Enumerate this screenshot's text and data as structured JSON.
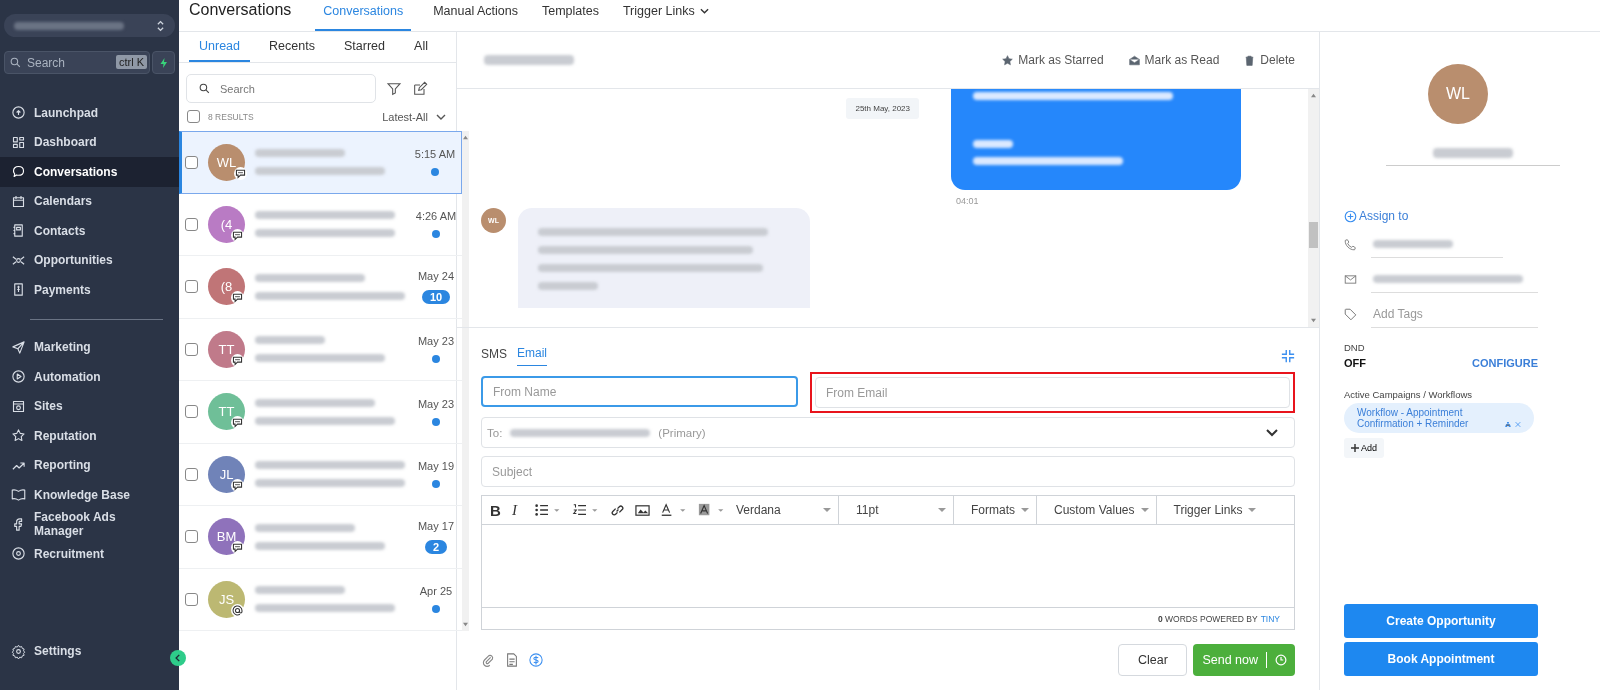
{
  "sidebar": {
    "search": {
      "placeholder": "Search",
      "shortcut": "ctrl K"
    },
    "sections": [
      [
        {
          "label": "Launchpad",
          "selected": false
        },
        {
          "label": "Dashboard",
          "selected": false
        },
        {
          "label": "Conversations",
          "selected": true
        },
        {
          "label": "Calendars",
          "selected": false
        },
        {
          "label": "Contacts",
          "selected": false
        },
        {
          "label": "Opportunities",
          "selected": false
        },
        {
          "label": "Payments",
          "selected": false
        }
      ],
      [
        {
          "label": "Marketing",
          "selected": false
        },
        {
          "label": "Automation",
          "selected": false
        },
        {
          "label": "Sites",
          "selected": false
        },
        {
          "label": "Reputation",
          "selected": false
        },
        {
          "label": "Reporting",
          "selected": false
        },
        {
          "label": "Knowledge Base",
          "selected": false
        },
        {
          "label": "Facebook Ads Manager",
          "selected": false
        },
        {
          "label": "Recruitment",
          "selected": false
        }
      ]
    ],
    "settings": "Settings"
  },
  "header": {
    "title": "Conversations",
    "tabs": [
      {
        "label": "Conversations",
        "selected": true,
        "has_menu": false
      },
      {
        "label": "Manual Actions",
        "selected": false,
        "has_menu": false
      },
      {
        "label": "Templates",
        "selected": false,
        "has_menu": false
      },
      {
        "label": "Trigger Links",
        "selected": false,
        "has_menu": true
      }
    ]
  },
  "list": {
    "tabs": [
      {
        "label": "Unread",
        "selected": true
      },
      {
        "label": "Recents",
        "selected": false
      },
      {
        "label": "Starred",
        "selected": false
      },
      {
        "label": "All",
        "selected": false
      }
    ],
    "search": {
      "placeholder": "Search"
    },
    "select_all": {
      "checked": false
    },
    "results": "8 RESULTS",
    "sort": "Latest-All",
    "rows": [
      {
        "initials": "WL",
        "color": "#b98e6e",
        "time": "5:15 AM",
        "unread": true,
        "kind": "sms",
        "selected": true,
        "checked": false
      },
      {
        "initials": "(4",
        "color": "#b97bc4",
        "time": "4:26 AM",
        "unread": true,
        "kind": "sms",
        "selected": false,
        "checked": false
      },
      {
        "initials": "(8",
        "color": "#c07577",
        "time": "May 24",
        "count": "10",
        "kind": "sms",
        "selected": false,
        "checked": false
      },
      {
        "initials": "TT",
        "color": "#c07a8a",
        "time": "May 23",
        "unread": true,
        "kind": "sms",
        "selected": false,
        "checked": false
      },
      {
        "initials": "TT",
        "color": "#6fbf98",
        "time": "May 23",
        "unread": true,
        "kind": "sms",
        "selected": false,
        "checked": false
      },
      {
        "initials": "JL",
        "color": "#7083b8",
        "time": "May 19",
        "unread": true,
        "kind": "sms",
        "selected": false,
        "checked": false
      },
      {
        "initials": "BM",
        "color": "#8f72bb",
        "time": "May 17",
        "count": "2",
        "kind": "sms",
        "selected": false,
        "checked": false
      },
      {
        "initials": "JS",
        "color": "#bcb872",
        "time": "Apr 25",
        "unread": true,
        "kind": "email",
        "selected": false,
        "checked": false
      }
    ]
  },
  "conversation": {
    "actions": [
      "Mark as Starred",
      "Mark as Read",
      "Delete"
    ],
    "date_chip": "25th May, 2023",
    "outgoing_time": "04:01",
    "incoming_initials": "WL"
  },
  "composer": {
    "tabs": [
      {
        "label": "SMS",
        "selected": false
      },
      {
        "label": "Email",
        "selected": true
      }
    ],
    "from_name": {
      "placeholder": "From Name",
      "focused": true
    },
    "from_email": {
      "placeholder": "From Email",
      "highlighted": true
    },
    "to_label": "To:",
    "to_note": "(Primary)",
    "subject": {
      "placeholder": "Subject"
    },
    "toolbar": {
      "bold": "B",
      "italic": "I",
      "font": "Verdana",
      "size": "11pt",
      "menus": [
        "Formats",
        "Custom Values",
        "Trigger Links"
      ]
    },
    "footer": {
      "words": "**0** WORDS POWERED BY",
      "brand": "TINY"
    },
    "clear": "Clear",
    "send": "Send now"
  },
  "contact": {
    "initials": "WL",
    "assign": "Assign to",
    "tags_placeholder": "Add Tags",
    "dnd_label": "DND",
    "dnd_value": "OFF",
    "configure": "CONFIGURE",
    "campaigns_label": "Active Campaigns / Workflows",
    "workflows": [
      "Workflow - Appointment Confirmation + Reminder"
    ],
    "add": "Add",
    "buttons": [
      "Create Opportunity",
      "Book Appointment"
    ]
  }
}
